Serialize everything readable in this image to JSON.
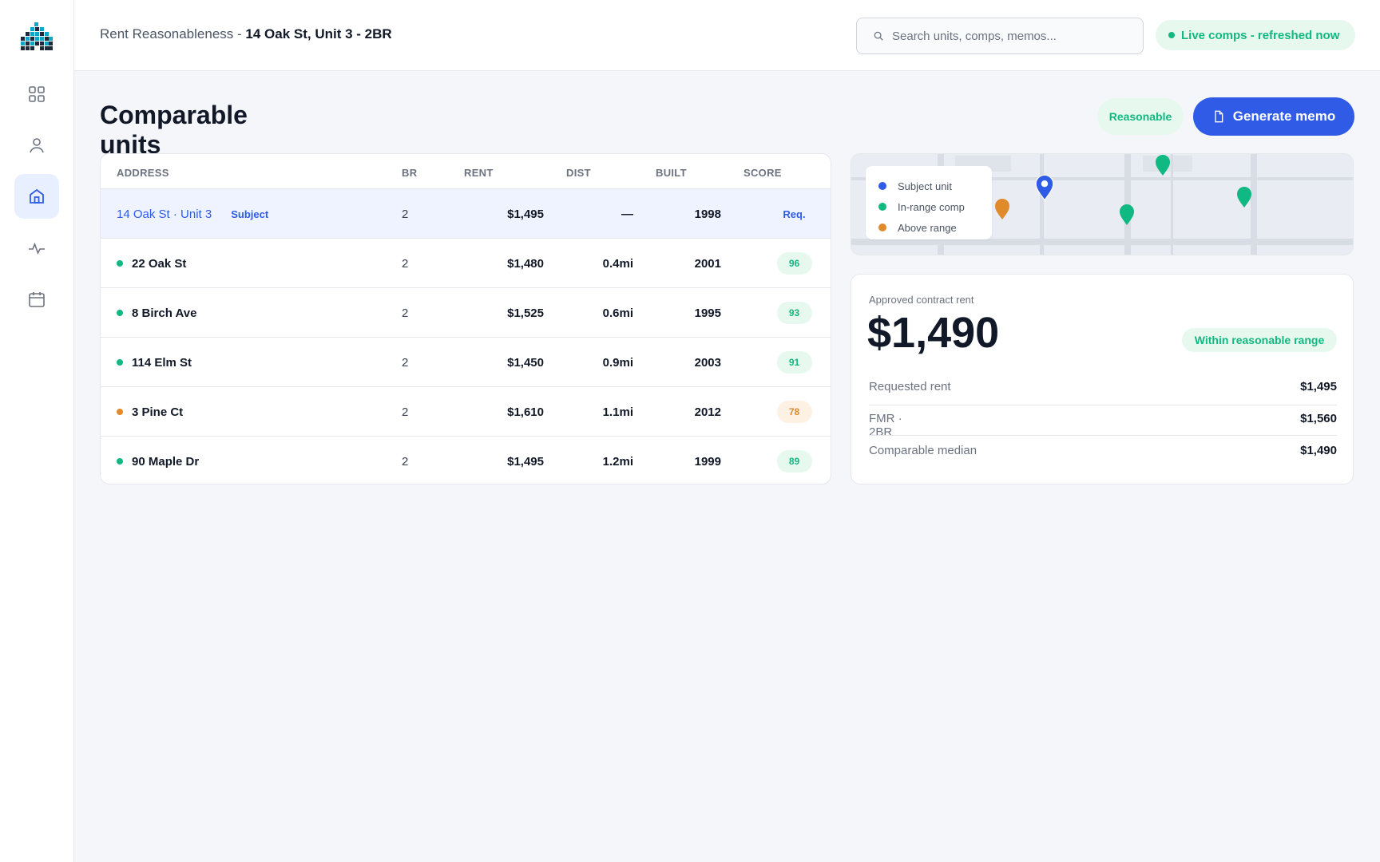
{
  "breadcrumb": {
    "section": "Rent Reasonableness",
    "separator": " - ",
    "subject": "14 Oak St, Unit 3 - 2BR"
  },
  "search": {
    "placeholder": "Search units, comps, memos..."
  },
  "status": {
    "text": "Live comps - refreshed now",
    "color": "#10b981"
  },
  "sidebar": {
    "items": [
      {
        "icon": "grid-icon"
      },
      {
        "icon": "user-icon"
      },
      {
        "icon": "home-icon",
        "active": true
      },
      {
        "icon": "activity-icon"
      },
      {
        "icon": "calendar-icon"
      }
    ]
  },
  "page": {
    "title": "Comparable units"
  },
  "actions": {
    "reasonable_label": "Reasonable",
    "generate_label": "Generate memo"
  },
  "table": {
    "headers": {
      "address": "ADDRESS",
      "br": "BR",
      "rent": "RENT",
      "dist": "DIST",
      "built": "BUILT",
      "score": "SCORE"
    },
    "subject": {
      "address": "14 Oak St · Unit 3",
      "badge": "Subject",
      "br": "2",
      "rent": "$1,495",
      "dist": "—",
      "built": "1998",
      "score": "Req."
    },
    "rows": [
      {
        "address": "22 Oak St",
        "br": "2",
        "rent": "$1,480",
        "dist": "0.4mi",
        "built": "2001",
        "score": "96",
        "status": "in-range"
      },
      {
        "address": "8 Birch Ave",
        "br": "2",
        "rent": "$1,525",
        "dist": "0.6mi",
        "built": "1995",
        "score": "93",
        "status": "in-range"
      },
      {
        "address": "114 Elm St",
        "br": "2",
        "rent": "$1,450",
        "dist": "0.9mi",
        "built": "2003",
        "score": "91",
        "status": "in-range"
      },
      {
        "address": "3 Pine Ct",
        "br": "2",
        "rent": "$1,610",
        "dist": "1.1mi",
        "built": "2012",
        "score": "78",
        "status": "above"
      },
      {
        "address": "90 Maple Dr",
        "br": "2",
        "rent": "$1,495",
        "dist": "1.2mi",
        "built": "1999",
        "score": "89",
        "status": "in-range"
      }
    ]
  },
  "map": {
    "legend": [
      {
        "label": "Subject unit",
        "color": "#2f5be7"
      },
      {
        "label": "In-range comp",
        "color": "#10b981"
      },
      {
        "label": "Above range",
        "color": "#e08a2c"
      }
    ]
  },
  "rent_card": {
    "label": "Approved contract rent",
    "value": "$1,490",
    "pill": "Within reasonable range",
    "rows": [
      {
        "label": "Requested rent",
        "value": "$1,495"
      },
      {
        "label": "FMR · 2BR",
        "value": "$1,560"
      },
      {
        "label": "Comparable median",
        "value": "$1,490"
      }
    ]
  },
  "colors": {
    "accent": "#2f5be7",
    "in_range": "#10b981",
    "above_range": "#e08a2c"
  }
}
